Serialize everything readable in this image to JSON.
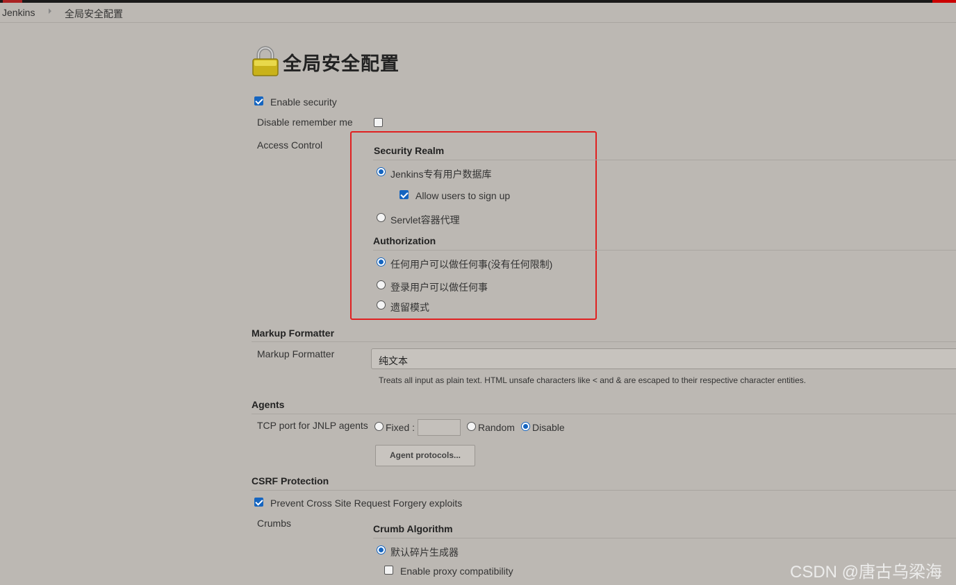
{
  "breadcrumb": {
    "root": "Jenkins",
    "current": "全局安全配置"
  },
  "page": {
    "title": "全局安全配置"
  },
  "security": {
    "enable_label": "Enable security",
    "enable_checked": true,
    "remember_label": "Disable remember me",
    "remember_checked": false,
    "access_control_label": "Access Control"
  },
  "security_realm": {
    "heading": "Security Realm",
    "options": [
      {
        "label": "Jenkins专有用户数据库",
        "selected": true
      },
      {
        "label": "Servlet容器代理",
        "selected": false
      }
    ],
    "allow_signup_label": "Allow users to sign up",
    "allow_signup_checked": true
  },
  "authorization": {
    "heading": "Authorization",
    "options": [
      {
        "label": "任何用户可以做任何事(没有任何限制)",
        "selected": true
      },
      {
        "label": "登录用户可以做任何事",
        "selected": false
      },
      {
        "label": "遗留模式",
        "selected": false
      }
    ]
  },
  "markup": {
    "heading": "Markup Formatter",
    "label": "Markup Formatter",
    "value": "纯文本",
    "description": "Treats all input as plain text. HTML unsafe characters like < and & are escaped to their respective character entities."
  },
  "agents": {
    "heading": "Agents",
    "tcp_label": "TCP port for JNLP agents",
    "fixed_label": "Fixed :",
    "random_label": "Random",
    "disable_label": "Disable",
    "selected": "Disable",
    "protocols_button": "Agent protocols..."
  },
  "csrf": {
    "heading": "CSRF Protection",
    "prevent_label": "Prevent Cross Site Request Forgery exploits",
    "prevent_checked": true,
    "crumbs_label": "Crumbs",
    "algorithm_heading": "Crumb Algorithm",
    "default_label": "默认碎片生成器",
    "default_selected": true,
    "proxy_label": "Enable proxy compatibility",
    "proxy_checked": false
  },
  "watermark": "CSDN @唐古乌梁海",
  "colors": {
    "highlight_box": "#e02020",
    "accent": "#1565c0"
  }
}
